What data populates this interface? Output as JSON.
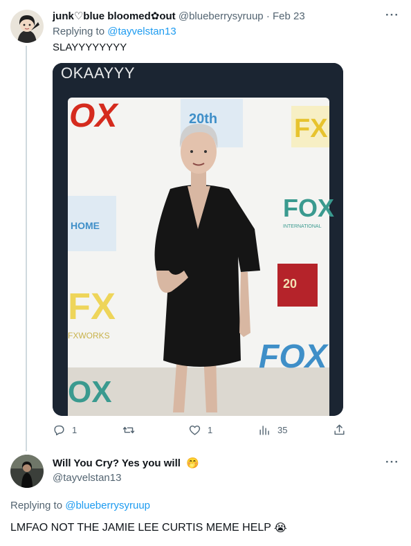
{
  "tweet1": {
    "display_name": "junk♡blue bloomed✿out",
    "handle": "@blueberrysyruup",
    "separator": "·",
    "date": "Feb 23",
    "replying_prefix": "Replying to",
    "replying_to": "@tayvelstan13",
    "text": "SLAYYYYYYYY",
    "more_label": "···",
    "media": {
      "caption": "OKAAYYY",
      "backdrop_logos": [
        "FOX",
        "20th CENTURY FOX HOME ENTERTAINMENT",
        "FX",
        "FOX INTERNATIONAL STUDIOS",
        "FXWORKS"
      ]
    },
    "actions": {
      "reply_count": "1",
      "retweet_count": "",
      "like_count": "1",
      "views_count": "35"
    }
  },
  "tweet2": {
    "display_name": "Will You Cry? Yes you will",
    "name_emoji": "🤭",
    "handle": "@tayvelstan13",
    "replying_prefix": "Replying to",
    "replying_to": "@blueberrysyruup",
    "text": "LMFAO NOT THE JAMIE LEE CURTIS MEME HELP",
    "text_emoji": "😭",
    "more_label": "···"
  },
  "colors": {
    "link": "#1d9bf0",
    "muted": "#536471",
    "text": "#0f1419",
    "thread_line": "#cfd9de"
  },
  "icons": [
    "reply-icon",
    "retweet-icon",
    "like-icon",
    "views-icon",
    "share-icon",
    "more-icon"
  ]
}
